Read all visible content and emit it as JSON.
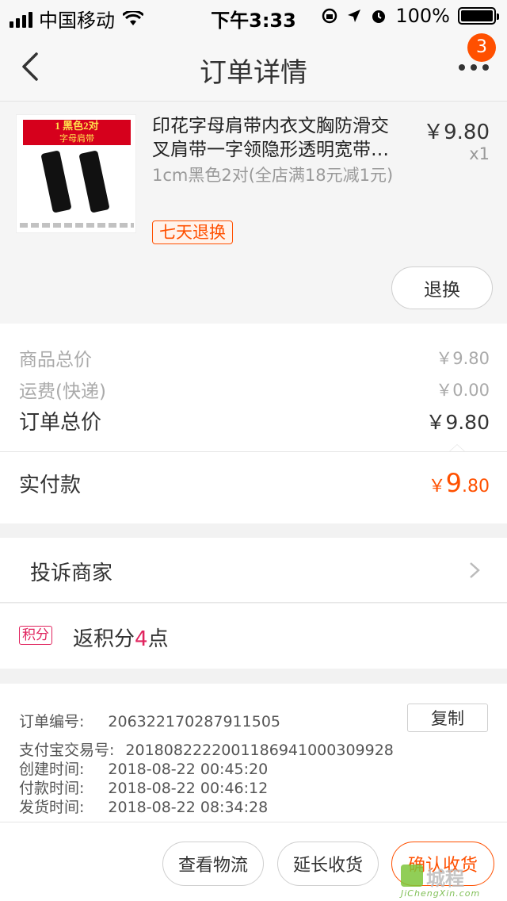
{
  "status_bar": {
    "carrier": "中国移动",
    "time": "下午3:33",
    "battery": "100%"
  },
  "nav": {
    "title": "订单详情",
    "badge_count": "3"
  },
  "product": {
    "image_banner": "1 黑色2对",
    "image_sub": "字母肩带",
    "title": "印花字母肩带内衣文胸防滑交叉肩带一字领隐形透明宽带…",
    "sku": "1cm黑色2对(全店满18元减1元)",
    "price": "￥9.80",
    "quantity": "x1",
    "tag": "七天退换",
    "refund_button": "退换"
  },
  "summary": {
    "goods_total_label": "商品总价",
    "goods_total_value": "￥9.80",
    "shipping_label": "运费(快递)",
    "shipping_value": "￥0.00",
    "order_total_label": "订单总价",
    "order_total_value": "￥9.80",
    "paid_label": "实付款",
    "paid_currency": "￥",
    "paid_int": "9",
    "paid_dec": ".80"
  },
  "complaint": {
    "label": "投诉商家"
  },
  "points": {
    "badge": "积分",
    "prefix": "返积分",
    "count": "4",
    "suffix": "点"
  },
  "order_info": {
    "order_no_label": "订单编号:",
    "order_no": "206322170287911505",
    "copy_button": "复制",
    "alipay_label": "支付宝交易号:",
    "alipay_no": "2018082222001186941000309928",
    "created_label": "创建时间:",
    "created": "2018-08-22 00:45:20",
    "paid_label": "付款时间:",
    "paid": "2018-08-22 00:46:12",
    "shipped_label": "发货时间:",
    "shipped": "2018-08-22 08:34:28"
  },
  "actions": {
    "logistics": "查看物流",
    "extend": "延长收货",
    "confirm": "确认收货"
  },
  "watermark": {
    "text": "城程",
    "url": "JiChengXin.com"
  },
  "colors": {
    "accent": "#ff5000",
    "points": "#e0245e"
  }
}
